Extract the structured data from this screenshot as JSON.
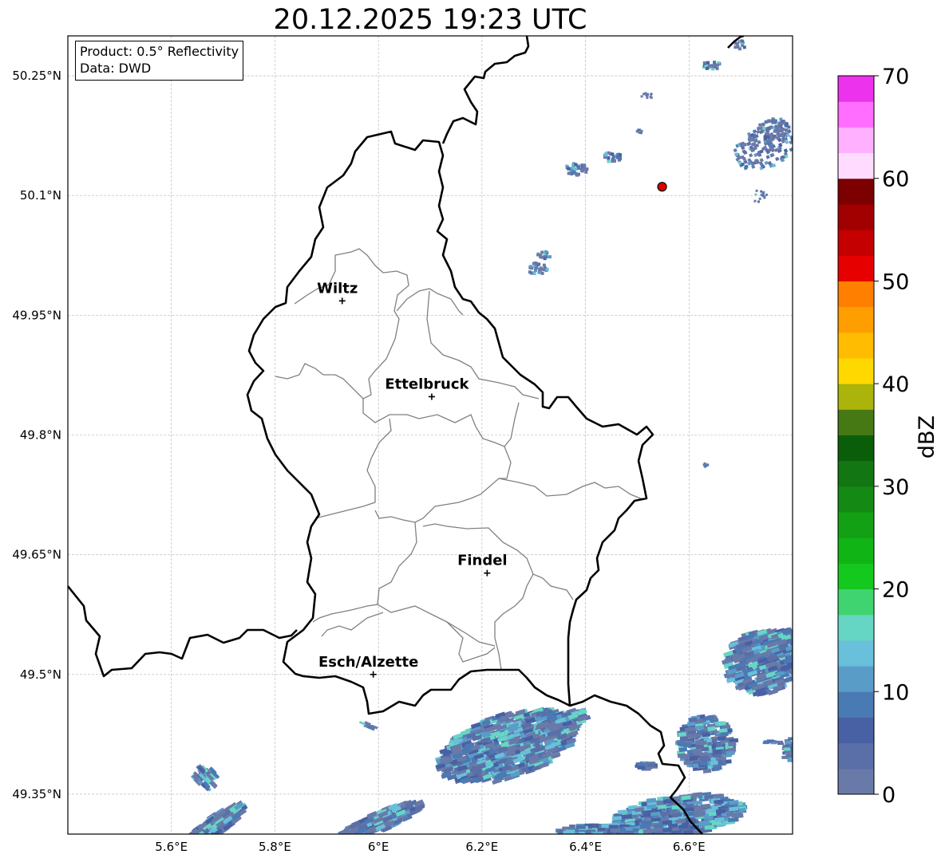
{
  "map": {
    "title": "20.12.2025 19:23 UTC",
    "info_box": {
      "product": "Product: 0.5° Reflectivity",
      "data": "Data: DWD"
    },
    "lon_ticks": [
      {
        "value": 5.6,
        "label": "5.6°E"
      },
      {
        "value": 5.8,
        "label": "5.8°E"
      },
      {
        "value": 6.0,
        "label": "6°E"
      },
      {
        "value": 6.2,
        "label": "6.2°E"
      },
      {
        "value": 6.4,
        "label": "6.4°E"
      },
      {
        "value": 6.6,
        "label": "6.6°E"
      }
    ],
    "lat_ticks": [
      {
        "value": 50.25,
        "label": "50.25°N"
      },
      {
        "value": 50.1,
        "label": "50.1°N"
      },
      {
        "value": 49.95,
        "label": "49.95°N"
      },
      {
        "value": 49.8,
        "label": "49.8°N"
      },
      {
        "value": 49.65,
        "label": "49.65°N"
      },
      {
        "value": 49.5,
        "label": "49.5°N"
      },
      {
        "value": 49.35,
        "label": "49.35°N"
      }
    ],
    "extent": {
      "lon": [
        5.4,
        6.8
      ],
      "lat": [
        49.3,
        50.3
      ]
    },
    "cities": [
      {
        "name": "Wiltz",
        "lon": 5.93,
        "lat": 49.968
      },
      {
        "name": "Ettelbruck",
        "lon": 6.103,
        "lat": 49.848
      },
      {
        "name": "Findel",
        "lon": 6.21,
        "lat": 49.627
      },
      {
        "name": "Esch/Alzette",
        "lon": 5.99,
        "lat": 49.5
      }
    ],
    "radar_site": {
      "lon": 6.548,
      "lat": 50.111,
      "color": "#dd0000"
    },
    "colorbar": {
      "label": "dBZ",
      "min": 0,
      "max": 70,
      "ticks": [
        "0",
        "10",
        "20",
        "30",
        "40",
        "50",
        "60",
        "70"
      ],
      "colors": [
        "#6a7aa8",
        "#5a6ea8",
        "#4860a4",
        "#4a7ab4",
        "#5a9cc8",
        "#68c0da",
        "#66d6c4",
        "#40d470",
        "#14c81e",
        "#10b414",
        "#14a014",
        "#148a14",
        "#127612",
        "#0a5e0a",
        "#467814",
        "#aab40a",
        "#ffd800",
        "#ffbc00",
        "#ff9e00",
        "#ff8000",
        "#e60000",
        "#c40000",
        "#a20000",
        "#7c0000",
        "#ffdcff",
        "#ffb0ff",
        "#ff6eff",
        "#ec32ec"
      ]
    }
  }
}
